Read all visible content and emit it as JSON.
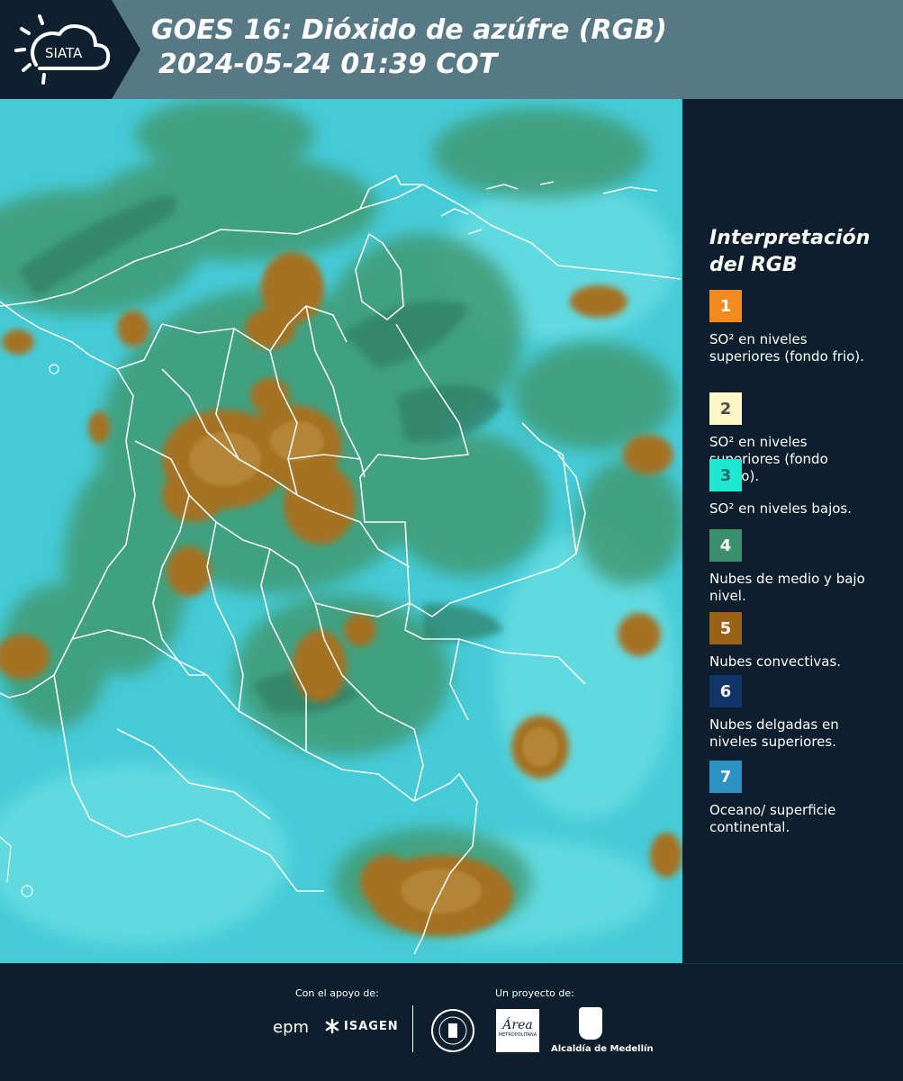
{
  "header": {
    "logo_text": "SIATA",
    "title_line1": "GOES 16: Dióxido de azúfre (RGB)",
    "title_line2": "2024-05-24 01:39 COT"
  },
  "legend": {
    "title_line1": "Interpretación",
    "title_line2": "del RGB",
    "items": [
      {
        "number": "1",
        "color": "#f58a1f",
        "text_color": "#ffffff",
        "label": "SO² en niveles superiores (fondo frio)."
      },
      {
        "number": "2",
        "color": "#fff7c8",
        "text_color": "#4a4a4a",
        "label": "SO² en niveles superiores (fondo calido)."
      },
      {
        "number": "3",
        "color": "#1ee8d2",
        "text_color": "#2a6a66",
        "label": "SO² en niveles bajos."
      },
      {
        "number": "4",
        "color": "#3a8f6e",
        "text_color": "#ffffff",
        "label": "Nubes de medio y bajo nivel."
      },
      {
        "number": "5",
        "color": "#9a6216",
        "text_color": "#ffffff",
        "label": "Nubes convectivas."
      },
      {
        "number": "6",
        "color": "#0f3568",
        "text_color": "#ffffff",
        "label": "Nubes delgadas en niveles superiores."
      },
      {
        "number": "7",
        "color": "#2b93c4",
        "text_color": "#ffffff",
        "label": "Oceano/ superficie continental."
      }
    ]
  },
  "footer": {
    "support_label": "Con el apoyo de:",
    "project_label": "Un proyecto de:",
    "sponsor1": "epm",
    "sponsor2": "ISAGEN",
    "partner1": "Área",
    "partner1_sub": "METROPOLITANA",
    "partner2": "Alcaldía de Medellín"
  },
  "colors": {
    "background": "#0d1f2e",
    "header_bar": "#567985",
    "map_cyan": "#43c9d6",
    "cloud_green": "#3a8f6e",
    "cloud_brown": "#9a6a22"
  }
}
